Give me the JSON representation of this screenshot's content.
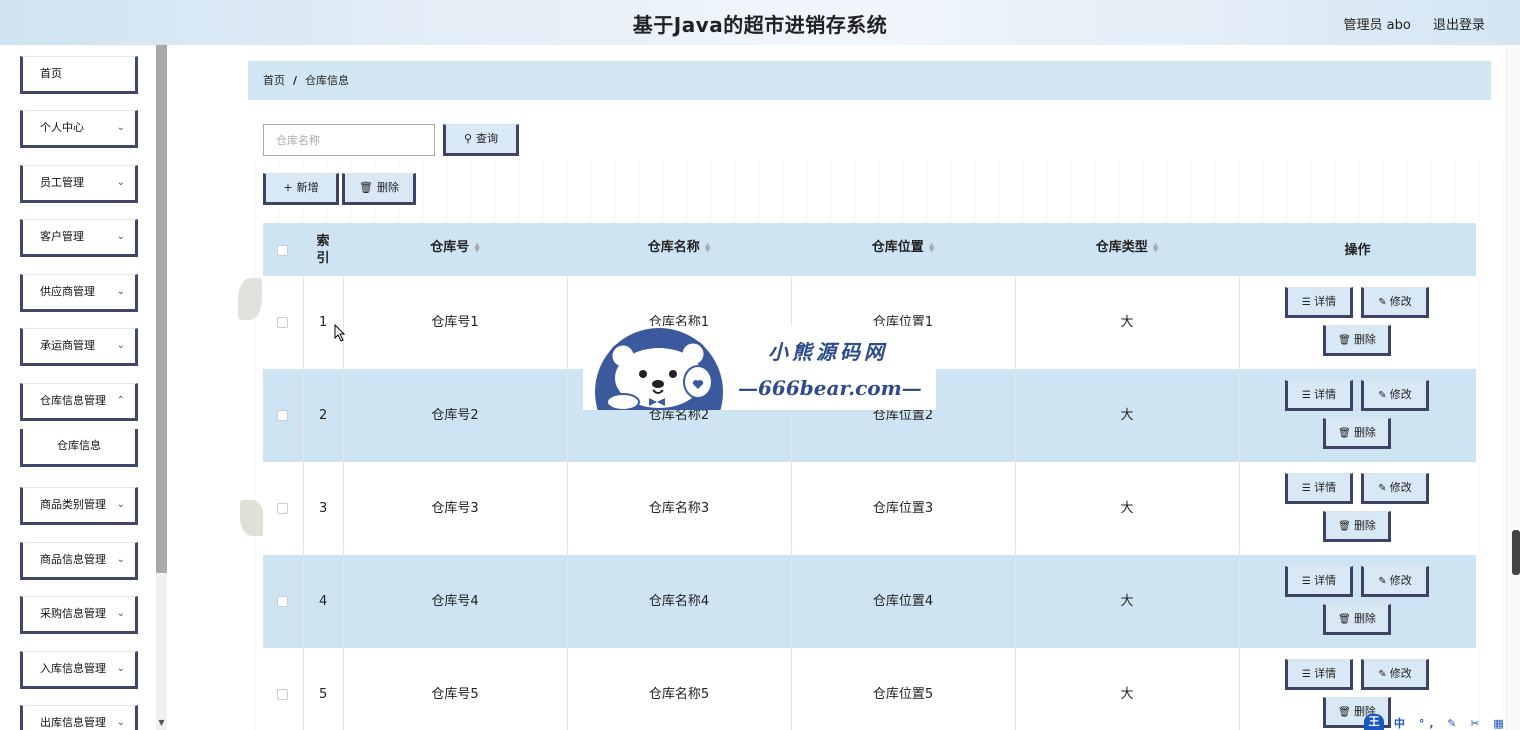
{
  "header": {
    "title": "基于Java的超市进销存系统",
    "user_label": "管理员 abo",
    "logout_label": "退出登录"
  },
  "sidebar": {
    "items": [
      {
        "label": "首页",
        "has_arrow": false
      },
      {
        "label": "个人中心",
        "has_arrow": true
      },
      {
        "label": "员工管理",
        "has_arrow": true
      },
      {
        "label": "客户管理",
        "has_arrow": true
      },
      {
        "label": "供应商管理",
        "has_arrow": true
      },
      {
        "label": "承运商管理",
        "has_arrow": true
      },
      {
        "label": "仓库信息管理",
        "has_arrow": true
      },
      {
        "label": "商品类别管理",
        "has_arrow": true
      },
      {
        "label": "商品信息管理",
        "has_arrow": true
      },
      {
        "label": "采购信息管理",
        "has_arrow": true
      },
      {
        "label": "入库信息管理",
        "has_arrow": true
      },
      {
        "label": "出库信息管理",
        "has_arrow": true
      }
    ],
    "submenu": {
      "label": "仓库信息"
    }
  },
  "breadcrumb": {
    "home": "首页",
    "separator": "/",
    "current": "仓库信息"
  },
  "search": {
    "placeholder": "仓库名称",
    "value": "",
    "button_label": "查询"
  },
  "toolbar": {
    "add_label": "新增",
    "delete_label": "删除"
  },
  "table": {
    "columns": {
      "index": "索引",
      "code": "仓库号",
      "name": "仓库名称",
      "location": "仓库位置",
      "type": "仓库类型",
      "actions": "操作"
    },
    "rows": [
      {
        "index": "1",
        "code": "仓库号1",
        "name": "仓库名称1",
        "location": "仓库位置1",
        "type": "大"
      },
      {
        "index": "2",
        "code": "仓库号2",
        "name": "仓库名称2",
        "location": "仓库位置2",
        "type": "大"
      },
      {
        "index": "3",
        "code": "仓库号3",
        "name": "仓库名称3",
        "location": "仓库位置3",
        "type": "大"
      },
      {
        "index": "4",
        "code": "仓库号4",
        "name": "仓库名称4",
        "location": "仓库位置4",
        "type": "大"
      },
      {
        "index": "5",
        "code": "仓库号5",
        "name": "仓库名称5",
        "location": "仓库位置5",
        "type": "大"
      }
    ],
    "action_labels": {
      "detail": "详情",
      "edit": "修改",
      "delete": "删除"
    }
  },
  "watermark": {
    "line1": "小熊源码网",
    "line2": "—666bear.com—"
  },
  "ime": {
    "badge": "王",
    "glyphs": "中 °, ✎ ✂ ▦ ⚙"
  },
  "colors": {
    "accent_dark": "#414769",
    "light_blue": "#cfe4f3",
    "header_gradient": "#cfe3f2",
    "watermark_blue": "#2c4c8c"
  }
}
